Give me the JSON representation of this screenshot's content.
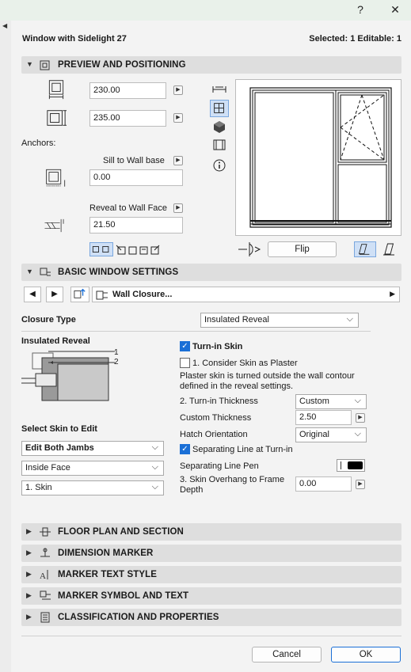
{
  "window": {
    "help": "?",
    "close": "✕"
  },
  "header": {
    "title": "Window with Sidelight 27",
    "selection": "Selected: 1 Editable: 1"
  },
  "preview": {
    "section_title": "PREVIEW AND POSITIONING",
    "width_value": "230.00",
    "height_value": "235.00",
    "anchors_label": "Anchors:",
    "sill_label": "Sill to Wall base",
    "sill_value": "0.00",
    "reveal_label": "Reveal to Wall Face",
    "reveal_value": "21.50",
    "flip_label": "Flip"
  },
  "basic": {
    "section_title": "BASIC WINDOW SETTINGS",
    "page_name": "Wall Closure...",
    "closure_type_label": "Closure Type",
    "closure_type_value": "Insulated Reveal",
    "insulated_reveal_label": "Insulated Reveal",
    "diagram_label_1": "1",
    "diagram_label_2": "2",
    "select_skin_label": "Select Skin to Edit",
    "skin_select_1": "Edit Both Jambs",
    "skin_select_2": "Inside Face",
    "skin_select_3": "1. Skin",
    "turn_in_skin_label": "Turn-in Skin",
    "turn_in_skin_checked": true,
    "consider_plaster_label": "1. Consider Skin as Plaster",
    "consider_plaster_checked": false,
    "plaster_note": "Plaster skin is turned outside the wall contour defined in the reveal settings.",
    "turn_in_thickness_label": "2. Turn-in Thickness",
    "turn_in_thickness_value": "Custom",
    "custom_thickness_label": "Custom Thickness",
    "custom_thickness_value": "2.50",
    "hatch_orientation_label": "Hatch Orientation",
    "hatch_orientation_value": "Original",
    "separating_line_label": "Separating Line at Turn-in",
    "separating_line_checked": true,
    "separating_pen_label": "Separating Line Pen",
    "skin_overhang_label": "3. Skin Overhang to Frame Depth",
    "skin_overhang_value": "0.00"
  },
  "collapsed_sections": [
    "FLOOR PLAN AND SECTION",
    "DIMENSION MARKER",
    "MARKER TEXT STYLE",
    "MARKER SYMBOL AND TEXT",
    "CLASSIFICATION AND PROPERTIES"
  ],
  "footer": {
    "cancel_label": "Cancel",
    "ok_label": "OK"
  },
  "colors": {
    "accent": "#1a6fd6",
    "section_bg": "#dedede",
    "titlebar_bg": "#e9f1ea"
  }
}
